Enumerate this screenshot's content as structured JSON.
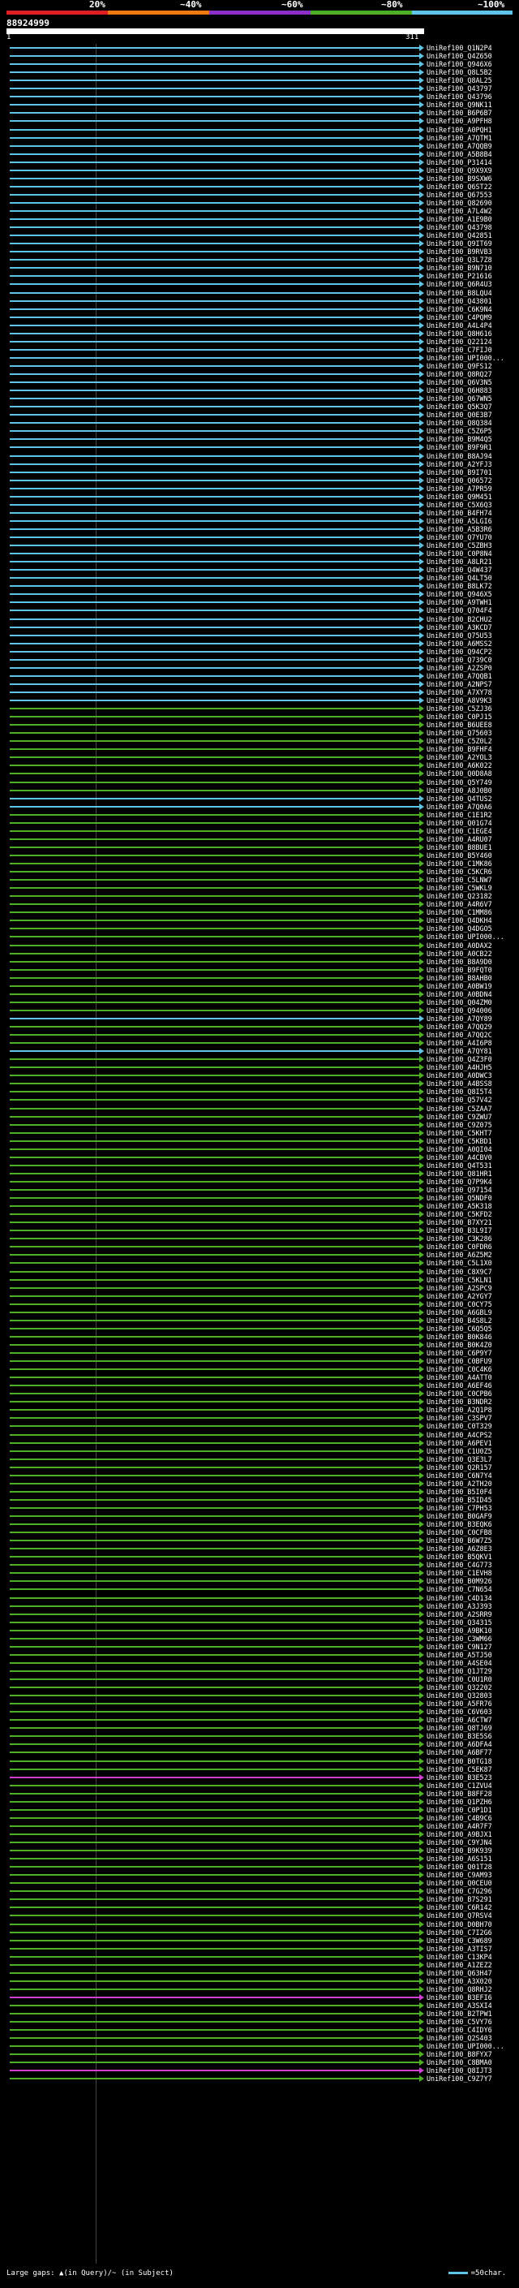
{
  "scale_labels": [
    "20%",
    "~40%",
    "~60%",
    "~80%",
    "~100%"
  ],
  "colors": {
    "red": "#e02020",
    "orange": "#f07a10",
    "purple": "#8b2fc9",
    "green": "#4caf26",
    "blue": "#5fc4e6",
    "magenta": "#d040d0"
  },
  "query_id": "88924999",
  "ruler_start": "1",
  "ruler_end": "311",
  "footer": {
    "gap_note": "Large gaps: ▲(in Query)/~ (in Subject)",
    "legend": "=50char."
  },
  "hits": [
    {
      "id": "UniRef100_Q1N2P4",
      "color": "blue"
    },
    {
      "id": "UniRef100_Q4Z650",
      "color": "blue"
    },
    {
      "id": "UniRef100_Q946X6",
      "color": "blue"
    },
    {
      "id": "UniRef100_Q8L5B2",
      "color": "blue"
    },
    {
      "id": "UniRef100_Q8AL25",
      "color": "blue"
    },
    {
      "id": "UniRef100_Q43797",
      "color": "blue"
    },
    {
      "id": "UniRef100_Q43796",
      "color": "blue"
    },
    {
      "id": "UniRef100_Q9NK11",
      "color": "blue"
    },
    {
      "id": "UniRef100_B6P6B7",
      "color": "blue"
    },
    {
      "id": "UniRef100_A9PFH8",
      "color": "blue"
    },
    {
      "id": "UniRef100_A0PQH1",
      "color": "blue"
    },
    {
      "id": "UniRef100_A7QTM1",
      "color": "blue"
    },
    {
      "id": "UniRef100_A7QQB9",
      "color": "blue"
    },
    {
      "id": "UniRef100_A5B8B4",
      "color": "blue"
    },
    {
      "id": "UniRef100_P31414",
      "color": "blue"
    },
    {
      "id": "UniRef100_Q9X9X9",
      "color": "blue"
    },
    {
      "id": "UniRef100_B9SXW6",
      "color": "blue"
    },
    {
      "id": "UniRef100_Q6ST22",
      "color": "blue"
    },
    {
      "id": "UniRef100_Q67553",
      "color": "blue"
    },
    {
      "id": "UniRef100_Q82690",
      "color": "blue"
    },
    {
      "id": "UniRef100_A7L4W2",
      "color": "blue"
    },
    {
      "id": "UniRef100_A1E9B0",
      "color": "blue"
    },
    {
      "id": "UniRef100_Q43798",
      "color": "blue"
    },
    {
      "id": "UniRef100_Q42851",
      "color": "blue"
    },
    {
      "id": "UniRef100_Q9IT69",
      "color": "blue"
    },
    {
      "id": "UniRef100_B9RVB3",
      "color": "blue"
    },
    {
      "id": "UniRef100_Q3L7Z8",
      "color": "blue"
    },
    {
      "id": "UniRef100_B9N710",
      "color": "blue"
    },
    {
      "id": "UniRef100_P21616",
      "color": "blue"
    },
    {
      "id": "UniRef100_Q6R4U3",
      "color": "blue"
    },
    {
      "id": "UniRef100_B8LQU4",
      "color": "blue"
    },
    {
      "id": "UniRef100_Q43801",
      "color": "blue"
    },
    {
      "id": "UniRef100_C6K9N4",
      "color": "blue"
    },
    {
      "id": "UniRef100_C4PQM9",
      "color": "blue"
    },
    {
      "id": "UniRef100_A4L4P4",
      "color": "blue"
    },
    {
      "id": "UniRef100_Q8H616",
      "color": "blue"
    },
    {
      "id": "UniRef100_Q22124",
      "color": "blue"
    },
    {
      "id": "UniRef100_C7FIJ0",
      "color": "blue"
    },
    {
      "id": "UniRef100_UPI000...",
      "color": "blue"
    },
    {
      "id": "UniRef100_Q9FS12",
      "color": "blue"
    },
    {
      "id": "UniRef100_Q8RQ27",
      "color": "blue"
    },
    {
      "id": "UniRef100_Q6V3N5",
      "color": "blue"
    },
    {
      "id": "UniRef100_Q6H883",
      "color": "blue"
    },
    {
      "id": "UniRef100_Q67WN5",
      "color": "blue"
    },
    {
      "id": "UniRef100_Q5K3Q7",
      "color": "blue"
    },
    {
      "id": "UniRef100_Q0E3B7",
      "color": "blue"
    },
    {
      "id": "UniRef100_Q8Q384",
      "color": "blue"
    },
    {
      "id": "UniRef100_C5Z6P5",
      "color": "blue"
    },
    {
      "id": "UniRef100_B9M4Q5",
      "color": "blue"
    },
    {
      "id": "UniRef100_B9F9R1",
      "color": "blue"
    },
    {
      "id": "UniRef100_B8AJ94",
      "color": "blue"
    },
    {
      "id": "UniRef100_A2YFJ3",
      "color": "blue"
    },
    {
      "id": "UniRef100_B9I701",
      "color": "blue"
    },
    {
      "id": "UniRef100_Q06572",
      "color": "blue"
    },
    {
      "id": "UniRef100_A7PR59",
      "color": "blue"
    },
    {
      "id": "UniRef100_Q9M451",
      "color": "blue"
    },
    {
      "id": "UniRef100_C5X6Q3",
      "color": "blue"
    },
    {
      "id": "UniRef100_B4FH74",
      "color": "blue"
    },
    {
      "id": "UniRef100_A5LGI6",
      "color": "blue"
    },
    {
      "id": "UniRef100_A5B3R6",
      "color": "blue"
    },
    {
      "id": "UniRef100_Q7YU70",
      "color": "blue"
    },
    {
      "id": "UniRef100_C5ZBH3",
      "color": "blue"
    },
    {
      "id": "UniRef100_C0P8N4",
      "color": "blue"
    },
    {
      "id": "UniRef100_A8LR21",
      "color": "blue"
    },
    {
      "id": "UniRef100_Q4W437",
      "color": "blue"
    },
    {
      "id": "UniRef100_Q4LT50",
      "color": "blue"
    },
    {
      "id": "UniRef100_B8LK72",
      "color": "blue"
    },
    {
      "id": "UniRef100_Q946X5",
      "color": "blue"
    },
    {
      "id": "UniRef100_A9TWH1",
      "color": "blue"
    },
    {
      "id": "UniRef100_Q704F4",
      "color": "blue"
    },
    {
      "id": "UniRef100_B2CHU2",
      "color": "blue"
    },
    {
      "id": "UniRef100_A3KCD7",
      "color": "blue"
    },
    {
      "id": "UniRef100_Q75U53",
      "color": "blue"
    },
    {
      "id": "UniRef100_A6MSS2",
      "color": "blue"
    },
    {
      "id": "UniRef100_Q94CP2",
      "color": "blue"
    },
    {
      "id": "UniRef100_Q739C0",
      "color": "blue"
    },
    {
      "id": "UniRef100_A2ZSP0",
      "color": "blue"
    },
    {
      "id": "UniRef100_A7QQB1",
      "color": "blue"
    },
    {
      "id": "UniRef100_A2NPS7",
      "color": "blue"
    },
    {
      "id": "UniRef100_A7XY78",
      "color": "blue"
    },
    {
      "id": "UniRef100_A8V9K3",
      "color": "blue"
    },
    {
      "id": "UniRef100_C5ZJ36",
      "color": "green"
    },
    {
      "id": "UniRef100_C0PJ15",
      "color": "green"
    },
    {
      "id": "UniRef100_B6UEE8",
      "color": "green"
    },
    {
      "id": "UniRef100_Q75603",
      "color": "green"
    },
    {
      "id": "UniRef100_C5Z0L2",
      "color": "green"
    },
    {
      "id": "UniRef100_B9FHF4",
      "color": "green"
    },
    {
      "id": "UniRef100_A2YOL3",
      "color": "green"
    },
    {
      "id": "UniRef100_A6K022",
      "color": "green"
    },
    {
      "id": "UniRef100_Q0D8A8",
      "color": "green"
    },
    {
      "id": "UniRef100_Q5Y749",
      "color": "green"
    },
    {
      "id": "UniRef100_A8J0B0",
      "color": "green"
    },
    {
      "id": "UniRef100_Q4TUS2",
      "color": "blue"
    },
    {
      "id": "UniRef100_A7Q0A6",
      "color": "blue"
    },
    {
      "id": "UniRef100_C1E1R2",
      "color": "green"
    },
    {
      "id": "UniRef100_Q01G74",
      "color": "green"
    },
    {
      "id": "UniRef100_C1EGE4",
      "color": "green"
    },
    {
      "id": "UniRef100_A4RU07",
      "color": "green"
    },
    {
      "id": "UniRef100_B8BUE1",
      "color": "green"
    },
    {
      "id": "UniRef100_B5Y460",
      "color": "green"
    },
    {
      "id": "UniRef100_C1MK86",
      "color": "green"
    },
    {
      "id": "UniRef100_C5KCR6",
      "color": "green"
    },
    {
      "id": "UniRef100_C5LNW7",
      "color": "green"
    },
    {
      "id": "UniRef100_C5WKL9",
      "color": "green"
    },
    {
      "id": "UniRef100_Q23182",
      "color": "green"
    },
    {
      "id": "UniRef100_A4R6V7",
      "color": "green"
    },
    {
      "id": "UniRef100_C1MM86",
      "color": "green"
    },
    {
      "id": "UniRef100_Q4DKH4",
      "color": "green"
    },
    {
      "id": "UniRef100_Q4DGO5",
      "color": "green"
    },
    {
      "id": "UniRef100_UPI000...",
      "color": "green"
    },
    {
      "id": "UniRef100_A0DAX2",
      "color": "green"
    },
    {
      "id": "UniRef100_A0CB22",
      "color": "green"
    },
    {
      "id": "UniRef100_B8A9D0",
      "color": "green"
    },
    {
      "id": "UniRef100_B9FQT0",
      "color": "green"
    },
    {
      "id": "UniRef100_B8AHB0",
      "color": "green"
    },
    {
      "id": "UniRef100_A0BW19",
      "color": "green"
    },
    {
      "id": "UniRef100_A0BDN4",
      "color": "green"
    },
    {
      "id": "UniRef100_Q04ZM0",
      "color": "green"
    },
    {
      "id": "UniRef100_Q94006",
      "color": "green"
    },
    {
      "id": "UniRef100_A7QY89",
      "color": "blue"
    },
    {
      "id": "UniRef100_A7QQ29",
      "color": "green"
    },
    {
      "id": "UniRef100_A7QQ2C",
      "color": "green"
    },
    {
      "id": "UniRef100_A4I6P8",
      "color": "green"
    },
    {
      "id": "UniRef100_A7QY81",
      "color": "blue"
    },
    {
      "id": "UniRef100_Q4Z3F0",
      "color": "green"
    },
    {
      "id": "UniRef100_A4HJH5",
      "color": "green"
    },
    {
      "id": "UniRef100_A0DWC3",
      "color": "green"
    },
    {
      "id": "UniRef100_A4BSS8",
      "color": "green"
    },
    {
      "id": "UniRef100_Q8I5T4",
      "color": "green"
    },
    {
      "id": "UniRef100_Q57V42",
      "color": "green"
    },
    {
      "id": "UniRef100_C5ZAA7",
      "color": "green"
    },
    {
      "id": "UniRef100_C9ZWU7",
      "color": "green"
    },
    {
      "id": "UniRef100_C9Z075",
      "color": "green"
    },
    {
      "id": "UniRef100_C5KHT7",
      "color": "green"
    },
    {
      "id": "UniRef100_C5KBD1",
      "color": "green"
    },
    {
      "id": "UniRef100_A0QI04",
      "color": "green"
    },
    {
      "id": "UniRef100_A4CBV0",
      "color": "green"
    },
    {
      "id": "UniRef100_Q4T531",
      "color": "green"
    },
    {
      "id": "UniRef100_Q81HR1",
      "color": "green"
    },
    {
      "id": "UniRef100_Q7P9K4",
      "color": "green"
    },
    {
      "id": "UniRef100_Q97154",
      "color": "green"
    },
    {
      "id": "UniRef100_Q5NDF0",
      "color": "green"
    },
    {
      "id": "UniRef100_A5K318",
      "color": "green"
    },
    {
      "id": "UniRef100_C5KFD2",
      "color": "green"
    },
    {
      "id": "UniRef100_B7XY21",
      "color": "green"
    },
    {
      "id": "UniRef100_B3L9I7",
      "color": "green"
    },
    {
      "id": "UniRef100_C3K286",
      "color": "green"
    },
    {
      "id": "UniRef100_C0FDR6",
      "color": "green"
    },
    {
      "id": "UniRef100_A6Z5M2",
      "color": "green"
    },
    {
      "id": "UniRef100_C5L1X0",
      "color": "green"
    },
    {
      "id": "UniRef100_C8X9C7",
      "color": "green"
    },
    {
      "id": "UniRef100_C5KLN1",
      "color": "green"
    },
    {
      "id": "UniRef100_A2SPC9",
      "color": "green"
    },
    {
      "id": "UniRef100_A2YGY7",
      "color": "green"
    },
    {
      "id": "UniRef100_C0CY75",
      "color": "green"
    },
    {
      "id": "UniRef100_A6GBL9",
      "color": "green"
    },
    {
      "id": "UniRef100_B4S8L2",
      "color": "green"
    },
    {
      "id": "UniRef100_C6Q5Q5",
      "color": "green"
    },
    {
      "id": "UniRef100_B0K846",
      "color": "green"
    },
    {
      "id": "UniRef100_B0K4Z0",
      "color": "green"
    },
    {
      "id": "UniRef100_C6P9Y7",
      "color": "green"
    },
    {
      "id": "UniRef100_C0BFU9",
      "color": "green"
    },
    {
      "id": "UniRef100_C0C4K6",
      "color": "green"
    },
    {
      "id": "UniRef100_A4ATT0",
      "color": "green"
    },
    {
      "id": "UniRef100_A6EF46",
      "color": "green"
    },
    {
      "id": "UniRef100_C0CPB6",
      "color": "green"
    },
    {
      "id": "UniRef100_B3NDR2",
      "color": "green"
    },
    {
      "id": "UniRef100_A2Q1P8",
      "color": "green"
    },
    {
      "id": "UniRef100_C3SPV7",
      "color": "green"
    },
    {
      "id": "UniRef100_C0T329",
      "color": "green"
    },
    {
      "id": "UniRef100_A4CPS2",
      "color": "green"
    },
    {
      "id": "UniRef100_A6PEV1",
      "color": "green"
    },
    {
      "id": "UniRef100_C1U0Z5",
      "color": "green"
    },
    {
      "id": "UniRef100_Q3E3L7",
      "color": "green"
    },
    {
      "id": "UniRef100_Q2R157",
      "color": "green"
    },
    {
      "id": "UniRef100_C6N7Y4",
      "color": "green"
    },
    {
      "id": "UniRef100_A2TH20",
      "color": "green"
    },
    {
      "id": "UniRef100_B5I0F4",
      "color": "green"
    },
    {
      "id": "UniRef100_B5ID45",
      "color": "green"
    },
    {
      "id": "UniRef100_C7PH53",
      "color": "green"
    },
    {
      "id": "UniRef100_B0GAF9",
      "color": "green"
    },
    {
      "id": "UniRef100_B3EQK6",
      "color": "green"
    },
    {
      "id": "UniRef100_C0CFB8",
      "color": "green"
    },
    {
      "id": "UniRef100_B6W7Z5",
      "color": "green"
    },
    {
      "id": "UniRef100_A6Z8E3",
      "color": "green"
    },
    {
      "id": "UniRef100_B5QKV1",
      "color": "green"
    },
    {
      "id": "UniRef100_C4G773",
      "color": "green"
    },
    {
      "id": "UniRef100_C1EVH8",
      "color": "green"
    },
    {
      "id": "UniRef100_B0M926",
      "color": "green"
    },
    {
      "id": "UniRef100_C7N654",
      "color": "green"
    },
    {
      "id": "UniRef100_C4D134",
      "color": "green"
    },
    {
      "id": "UniRef100_A3J393",
      "color": "green"
    },
    {
      "id": "UniRef100_A2SRR9",
      "color": "green"
    },
    {
      "id": "UniRef100_Q34315",
      "color": "green"
    },
    {
      "id": "UniRef100_A9BK10",
      "color": "green"
    },
    {
      "id": "UniRef100_C3WM66",
      "color": "green"
    },
    {
      "id": "UniRef100_C9N127",
      "color": "green"
    },
    {
      "id": "UniRef100_A5TJ50",
      "color": "green"
    },
    {
      "id": "UniRef100_A4SE04",
      "color": "green"
    },
    {
      "id": "UniRef100_Q1JT29",
      "color": "green"
    },
    {
      "id": "UniRef100_C0U1R0",
      "color": "green"
    },
    {
      "id": "UniRef100_Q32202",
      "color": "green"
    },
    {
      "id": "UniRef100_Q32803",
      "color": "green"
    },
    {
      "id": "UniRef100_A5FR76",
      "color": "green"
    },
    {
      "id": "UniRef100_C6V603",
      "color": "green"
    },
    {
      "id": "UniRef100_A6CTW7",
      "color": "green"
    },
    {
      "id": "UniRef100_Q8TJ69",
      "color": "green"
    },
    {
      "id": "UniRef100_B3E5S6",
      "color": "green"
    },
    {
      "id": "UniRef100_A6DFA4",
      "color": "green"
    },
    {
      "id": "UniRef100_A6BF77",
      "color": "green"
    },
    {
      "id": "UniRef100_B0TG18",
      "color": "green"
    },
    {
      "id": "UniRef100_C5EK87",
      "color": "green"
    },
    {
      "id": "UniRef100_B3E523",
      "color": "magenta"
    },
    {
      "id": "UniRef100_C1ZVU4",
      "color": "green"
    },
    {
      "id": "UniRef100_B8FF28",
      "color": "green"
    },
    {
      "id": "UniRef100_Q1PZH6",
      "color": "green"
    },
    {
      "id": "UniRef100_C0P1D1",
      "color": "green"
    },
    {
      "id": "UniRef100_C4B9C6",
      "color": "green"
    },
    {
      "id": "UniRef100_A4R7F7",
      "color": "green"
    },
    {
      "id": "UniRef100_A9BJX1",
      "color": "green"
    },
    {
      "id": "UniRef100_C9YJN4",
      "color": "green"
    },
    {
      "id": "UniRef100_B9K939",
      "color": "green"
    },
    {
      "id": "UniRef100_A6S151",
      "color": "green"
    },
    {
      "id": "UniRef100_Q01T28",
      "color": "green"
    },
    {
      "id": "UniRef100_C9AM93",
      "color": "green"
    },
    {
      "id": "UniRef100_Q0CEU0",
      "color": "green"
    },
    {
      "id": "UniRef100_C7G296",
      "color": "green"
    },
    {
      "id": "UniRef100_B7S291",
      "color": "green"
    },
    {
      "id": "UniRef100_C6R142",
      "color": "green"
    },
    {
      "id": "UniRef100_Q7RSV4",
      "color": "green"
    },
    {
      "id": "UniRef100_D0BH70",
      "color": "green"
    },
    {
      "id": "UniRef100_C7I2G6",
      "color": "green"
    },
    {
      "id": "UniRef100_C3W689",
      "color": "green"
    },
    {
      "id": "UniRef100_A3TIS7",
      "color": "green"
    },
    {
      "id": "UniRef100_C13KP4",
      "color": "green"
    },
    {
      "id": "UniRef100_A1ZEZ2",
      "color": "green"
    },
    {
      "id": "UniRef100_Q63H47",
      "color": "green"
    },
    {
      "id": "UniRef100_A3X020",
      "color": "green"
    },
    {
      "id": "UniRef100_Q8RHJ2",
      "color": "green"
    },
    {
      "id": "UniRef100_B3EFI6",
      "color": "magenta"
    },
    {
      "id": "UniRef100_A3SXI4",
      "color": "green"
    },
    {
      "id": "UniRef100_B2TPW1",
      "color": "green"
    },
    {
      "id": "UniRef100_C5VY76",
      "color": "green"
    },
    {
      "id": "UniRef100_C4IDY6",
      "color": "green"
    },
    {
      "id": "UniRef100_Q2S403",
      "color": "green"
    },
    {
      "id": "UniRef100_UPI000...",
      "color": "green"
    },
    {
      "id": "UniRef100_B8FYX7",
      "color": "green"
    },
    {
      "id": "UniRef100_C8BMA0",
      "color": "green"
    },
    {
      "id": "UniRef100_Q8IJT3",
      "color": "magenta"
    },
    {
      "id": "UniRef100_C9Z7Y7",
      "color": "green"
    }
  ]
}
